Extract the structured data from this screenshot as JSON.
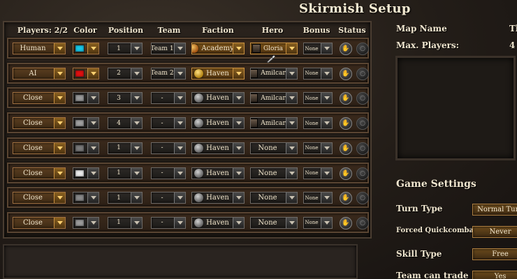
{
  "title": "Skirmish Setup",
  "headers": {
    "players": "Players: 2/2",
    "color": "Color",
    "position": "Position",
    "team": "Team",
    "faction": "Faction",
    "hero": "Hero",
    "bonus": "Bonus",
    "status": "Status"
  },
  "rows": [
    {
      "player": "Human",
      "color": "#18c8e8",
      "position": "1",
      "team": "Team 1",
      "faction": "Academy",
      "faction_icon": "academy-icon",
      "hero": "Gloria",
      "hero_portrait": true,
      "bonus": "None"
    },
    {
      "player": "AI",
      "color": "#e01010",
      "position": "2",
      "team": "Team 2",
      "faction": "Haven",
      "faction_icon": "haven-icon",
      "hero": "Amilcar",
      "hero_portrait": true,
      "bonus": "None"
    },
    {
      "player": "Close",
      "color": "#9a9a9a",
      "position": "3",
      "team": "-",
      "faction": "Haven",
      "faction_icon": "haven-grey-icon",
      "hero": "Amilcar",
      "hero_portrait": true,
      "bonus": "None"
    },
    {
      "player": "Close",
      "color": "#a0a0a0",
      "position": "4",
      "team": "-",
      "faction": "Haven",
      "faction_icon": "haven-grey-icon",
      "hero": "Amilcar",
      "hero_portrait": true,
      "bonus": "None"
    },
    {
      "player": "Close",
      "color": "#7a7a7a",
      "position": "1",
      "team": "-",
      "faction": "Haven",
      "faction_icon": "haven-grey-icon",
      "hero": "None",
      "hero_portrait": false,
      "bonus": "None"
    },
    {
      "player": "Close",
      "color": "#ececec",
      "position": "1",
      "team": "-",
      "faction": "Haven",
      "faction_icon": "haven-grey-icon",
      "hero": "None",
      "hero_portrait": false,
      "bonus": "None"
    },
    {
      "player": "Close",
      "color": "#8a8a8a",
      "position": "1",
      "team": "-",
      "faction": "Haven",
      "faction_icon": "haven-grey-icon",
      "hero": "None",
      "hero_portrait": false,
      "bonus": "None"
    },
    {
      "player": "Close",
      "color": "#9c9c9c",
      "position": "1",
      "team": "-",
      "faction": "Haven",
      "faction_icon": "haven-grey-icon",
      "hero": "None",
      "hero_portrait": false,
      "bonus": "None"
    }
  ],
  "map_info": {
    "name_label": "Map Name",
    "name_value": "Th",
    "max_players_label": "Max. Players:",
    "max_players_value": "4"
  },
  "game_settings": {
    "title": "Game Settings",
    "items": [
      {
        "label": "Turn Type",
        "value": "Normal Turn"
      },
      {
        "label": "Forced Quickcombat",
        "value": "Never"
      },
      {
        "label": "Skill Type",
        "value": "Free"
      },
      {
        "label": "Team can trade",
        "value": "Yes"
      }
    ]
  },
  "colors": {
    "accent_gold": "#c89040",
    "panel_bg": "#2a231d"
  }
}
